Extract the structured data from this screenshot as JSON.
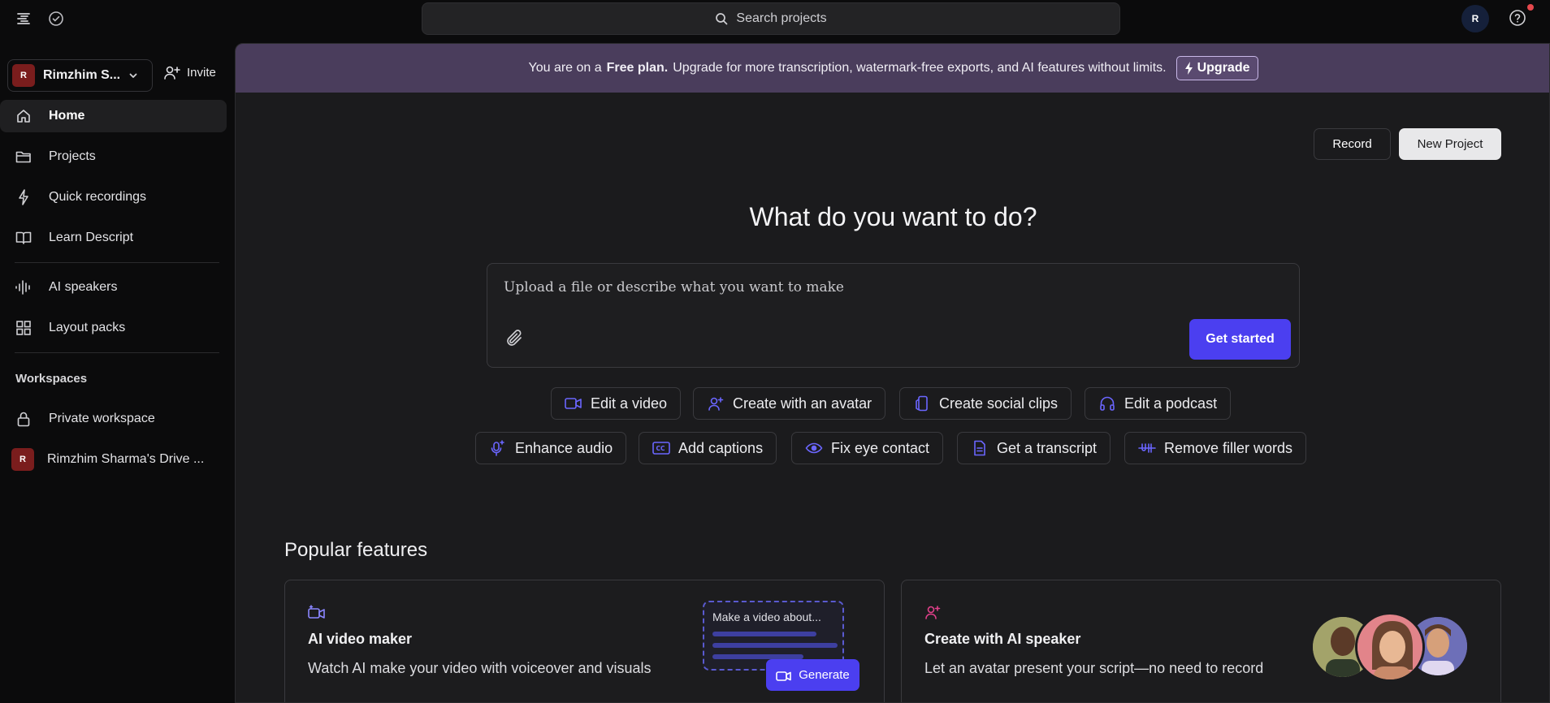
{
  "topbar": {
    "search_placeholder": "Search projects",
    "avatar_initial": "R"
  },
  "sidebar": {
    "workspace_initial": "R",
    "workspace_name": "Rimzhim S...",
    "invite_label": "Invite",
    "nav": [
      {
        "label": "Home",
        "icon": "home-icon"
      },
      {
        "label": "Projects",
        "icon": "folder-icon"
      },
      {
        "label": "Quick recordings",
        "icon": "lightning-icon"
      },
      {
        "label": "Learn Descript",
        "icon": "book-icon"
      },
      {
        "label": "AI speakers",
        "icon": "waveform-icon"
      },
      {
        "label": "Layout packs",
        "icon": "grid-icon"
      }
    ],
    "workspaces_title": "Workspaces",
    "private_workspace": "Private workspace",
    "drive_initial": "R",
    "drive_name": "Rimzhim Sharma's Drive ..."
  },
  "banner": {
    "prefix": "You are on a",
    "plan": "Free plan.",
    "suffix": "Upgrade for more transcription, watermark-free exports, and AI features without limits.",
    "upgrade_label": "Upgrade"
  },
  "actions": {
    "record": "Record",
    "new_project": "New Project"
  },
  "hero": {
    "headline": "What do you want to do?",
    "prompt_placeholder": "Upload a file or describe what you want to make",
    "get_started": "Get started"
  },
  "chips_row1": [
    {
      "label": "Edit a video",
      "icon": "video-camera-icon"
    },
    {
      "label": "Create with an avatar",
      "icon": "avatar-plus-icon"
    },
    {
      "label": "Create social clips",
      "icon": "phone-clip-icon"
    },
    {
      "label": "Edit a podcast",
      "icon": "headphones-icon"
    }
  ],
  "chips_row2": [
    {
      "label": "Enhance audio",
      "icon": "mic-sparkle-icon"
    },
    {
      "label": "Add captions",
      "icon": "cc-icon"
    },
    {
      "label": "Fix eye contact",
      "icon": "eye-icon"
    },
    {
      "label": "Get a transcript",
      "icon": "document-icon"
    },
    {
      "label": "Remove filler words",
      "icon": "strikethrough-icon"
    }
  ],
  "popular": {
    "title": "Popular features",
    "cards": [
      {
        "title": "AI video maker",
        "desc": "Watch AI make your video with voiceover and visuals",
        "mock_text": "Make a video about...",
        "generate": "Generate",
        "icon": "video-sparkle-icon"
      },
      {
        "title": "Create with AI speaker",
        "desc": "Let an avatar present your script—no need to record",
        "icon": "avatar-plus-icon"
      }
    ]
  },
  "colors": {
    "accent": "#4b3ff0",
    "banner": "#4a3d5c",
    "avatar_red": "#7a1d1d"
  }
}
